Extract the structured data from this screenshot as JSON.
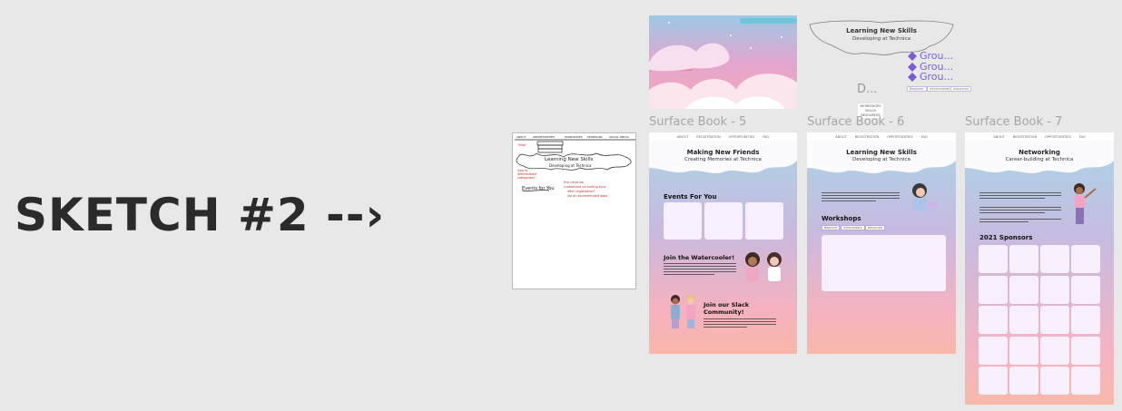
{
  "heading": "SKETCH #2 --›",
  "frames": {
    "f5": {
      "label": "Surface Book - 5",
      "title": "Making New Friends",
      "subtitle": "Creating Memories at Technica",
      "sections": [
        "Events For You",
        "Join the Watercooler!",
        "Join our Slack Community!"
      ]
    },
    "f6": {
      "label": "Surface Book - 6",
      "title": "Learning New Skills",
      "subtitle": "Developing at Technica",
      "sections": [
        "Workshops"
      ],
      "pills": [
        "Beginner",
        "Intermediate",
        "Advanced"
      ]
    },
    "f7": {
      "label": "Surface Book - 7",
      "title": "Networking",
      "subtitle": "Career-building at Technica",
      "sections": [
        "2021 Sponsors"
      ]
    }
  },
  "nav": [
    "ABOUT",
    "REGISTRATION",
    "OPPORTUNITIES",
    "FAQ"
  ],
  "top_header": {
    "title": "Learning New Skills",
    "subtitle": "Developing at Technica",
    "groups": [
      "Grou...",
      "Grou...",
      "Grou..."
    ],
    "pills": [
      "Beginner",
      "Intermediate",
      "Advanced"
    ],
    "d_label": "D...",
    "tiny_box": [
      "WORKSHOPS",
      "SKILLS",
      "RESOURCES"
    ]
  },
  "sketch_paper": {
    "heading": "Learning New Skills",
    "sub": "Developing at Technica",
    "note": "Events for You"
  },
  "colors": {
    "purple": "#7c5cd6",
    "card": "#f7f0fc"
  }
}
